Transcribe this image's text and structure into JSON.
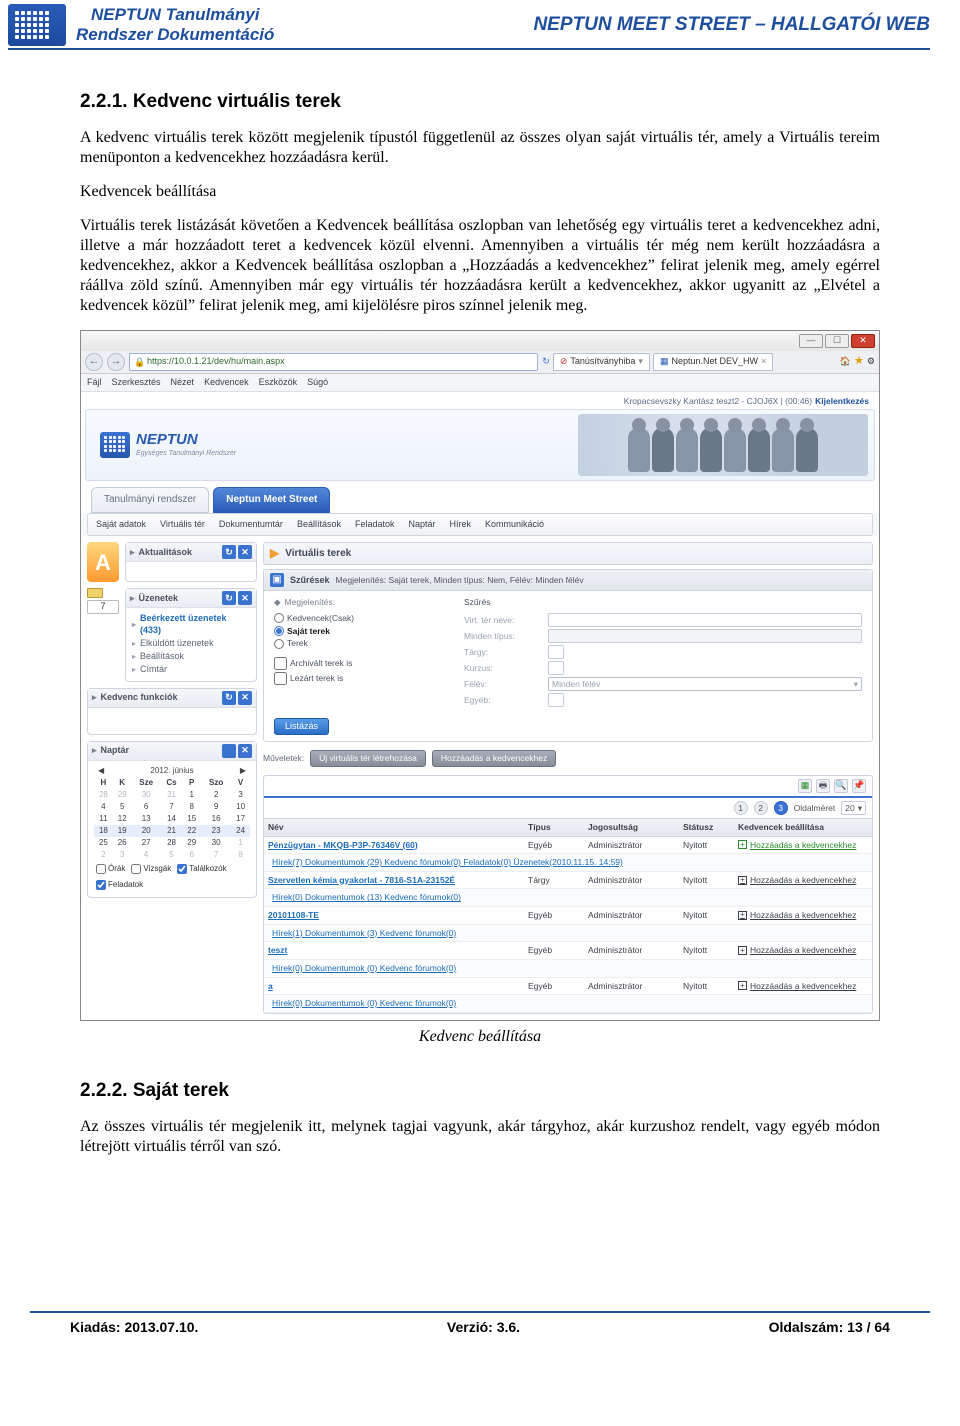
{
  "header": {
    "left_line1": "NEPTUN Tanulmányi",
    "left_line2": "Rendszer Dokumentáció",
    "right": "NEPTUN MEET STREET – HALLGATÓI WEB"
  },
  "section1": {
    "heading": "2.2.1. Kedvenc virtuális terek",
    "p1": "A kedvenc virtuális terek között megjelenik típustól függetlenül az összes olyan saját virtuális tér, amely a Virtuális tereim menüponton a kedvencekhez hozzáadásra kerül.",
    "p2": "Kedvencek beállítása",
    "p3": "Virtuális terek listázását követően a Kedvencek beállítása oszlopban van lehetőség egy virtuális teret a kedvencekhez adni, illetve a már hozzáadott teret a kedvencek közül elvenni. Amennyiben a virtuális tér még nem került hozzáadásra a kedvencekhez, akkor a Kedvencek beállítása oszlopban a „Hozzáadás a kedvencekhez” felirat jelenik meg, amely egérrel ráállva zöld színű. Amennyiben már egy virtuális tér hozzáadásra került a kedvencekhez, akkor ugyanitt az „Elvétel a kedvencek közül” felirat jelenik meg, ami kijelölésre piros színnel jelenik meg."
  },
  "screenshot": {
    "addr": "https://10.0.1.21/dev/hu/main.aspx",
    "addr_aux1": "Tanúsítványhiba",
    "addr_aux2": "Neptun.Net DEV_HW",
    "menus": [
      "Fájl",
      "Szerkesztés",
      "Nézet",
      "Kedvencek",
      "Eszközök",
      "Súgó"
    ],
    "banner_user": "Kropacsevszky Kantász teszt2 - CJOJ6X | (00:46)",
    "banner_logout": "Kijelentkezés",
    "logo_text": "NEPTUN",
    "logo_sub": "Egységes Tanulmányi Rendszer",
    "big_tabs": [
      "Tanulmányi rendszer",
      "Neptun Meet Street"
    ],
    "mainbar": [
      "Saját adatok",
      "Virtuális tér",
      "Dokumentumtár",
      "Beállítások",
      "Feladatok",
      "Naptár",
      "Hírek",
      "Kommunikáció"
    ],
    "side": {
      "akt": "Aktualitások",
      "uzen": "Üzenetek",
      "msgs": [
        {
          "label": "Beérkezett üzenetek (433)",
          "active": true
        },
        {
          "label": "Elküldött üzenetek",
          "active": false
        },
        {
          "label": "Beállítások",
          "active": false
        },
        {
          "label": "Címtár",
          "active": false
        }
      ],
      "kedv": "Kedvenc funkciók",
      "naptar": "Naptár",
      "cal_title": "2012. június",
      "cal_days": [
        "H",
        "K",
        "Sze",
        "Cs",
        "P",
        "Szo",
        "V"
      ],
      "cal_rows": [
        [
          "28",
          "29",
          "30",
          "31",
          "1",
          "2",
          "3"
        ],
        [
          "4",
          "5",
          "6",
          "7",
          "8",
          "9",
          "10"
        ],
        [
          "11",
          "12",
          "13",
          "14",
          "15",
          "16",
          "17"
        ],
        [
          "18",
          "19",
          "20",
          "21",
          "22",
          "23",
          "24"
        ],
        [
          "25",
          "26",
          "27",
          "28",
          "29",
          "30",
          "1"
        ],
        [
          "2",
          "3",
          "4",
          "5",
          "6",
          "7",
          "8"
        ]
      ],
      "cal_checks": [
        "Órák",
        "Vizsgák",
        "Találkozók",
        "Feladatok"
      ]
    },
    "main": {
      "title": "Virtuális terek",
      "szures": "Szűrések",
      "szures_sum": "Megjelenítés: Saját terek, Minden típus: Nem, Félév: Minden félév",
      "megj": "Megjelenítés:",
      "opts": [
        "Kedvencek(Csak)",
        "Saját terek",
        "Terek"
      ],
      "arch": "Archivált terek is",
      "lezart": "Lezárt terek is",
      "szcol": "Szűrés",
      "fields": [
        "Virt. tér neve:",
        "Minden típus:",
        "Tárgy:",
        "Kurzus:",
        "Félév:",
        "Egyéb:"
      ],
      "felev_val": "Minden félév",
      "listazas": "Listázás",
      "muv": "Műveletek:",
      "ops": [
        "Új virtuális tér létrehozása",
        "Hozzáadás a kedvencekhez"
      ],
      "pager_label": "Oldalméret",
      "pager_val": "20",
      "cols": [
        "Név",
        "Típus",
        "Jogosultság",
        "Státusz",
        "Kedvencek beállítása"
      ],
      "rows": [
        {
          "name": "Pénzügytan - MKQB-P3P-76346V (60)",
          "sub": "Hírek(7)   Dokumentumok (29)   Kedvenc fórumok(0)   Feladatok(0)   Üzenetek(2010.11.15. 14:59)",
          "type": "Egyéb",
          "role": "Adminisztrátor",
          "stat": "Nyitott",
          "fav": "Hozzáadás a kedvencekhez",
          "green": true
        },
        {
          "name": "Szervetlen kémia gyakorlat - 7816-S1A-23152É",
          "sub": "Hírek(0)   Dokumentumok (13)   Kedvenc fórumok(0)",
          "type": "Tárgy",
          "role": "Adminisztrátor",
          "stat": "Nyitott",
          "fav": "Hozzáadás a kedvencekhez",
          "green": false
        },
        {
          "name": "20101108-TE",
          "sub": "Hírek(1)   Dokumentumok (3)   Kedvenc fórumok(0)",
          "type": "Egyéb",
          "role": "Adminisztrátor",
          "stat": "Nyitott",
          "fav": "Hozzáadás a kedvencekhez",
          "green": false
        },
        {
          "name": "teszt",
          "sub": "Hírek(0)   Dokumentumok (0)   Kedvenc fórumok(0)",
          "type": "Egyéb",
          "role": "Adminisztrátor",
          "stat": "Nyitott",
          "fav": "Hozzáadás a kedvencekhez",
          "green": false
        },
        {
          "name": "a",
          "sub": "Hírek(0)   Dokumentumok (0)   Kedvenc fórumok(0)",
          "type": "Egyéb",
          "role": "Adminisztrátor",
          "stat": "Nyitott",
          "fav": "Hozzáadás a kedvencekhez",
          "green": false
        }
      ]
    },
    "caption": "Kedvenc beállítása"
  },
  "section2": {
    "heading": "2.2.2. Saját terek",
    "p1": "Az összes virtuális tér megjelenik itt, melynek tagjai vagyunk, akár tárgyhoz, akár kurzushoz rendelt, vagy egyéb módon létrejött virtuális térről van szó."
  },
  "footer": {
    "kiadas": "Kiadás: 2013.07.10.",
    "verzio": "Verzió: 3.6.",
    "oldal": "Oldalszám: 13 / 64"
  }
}
